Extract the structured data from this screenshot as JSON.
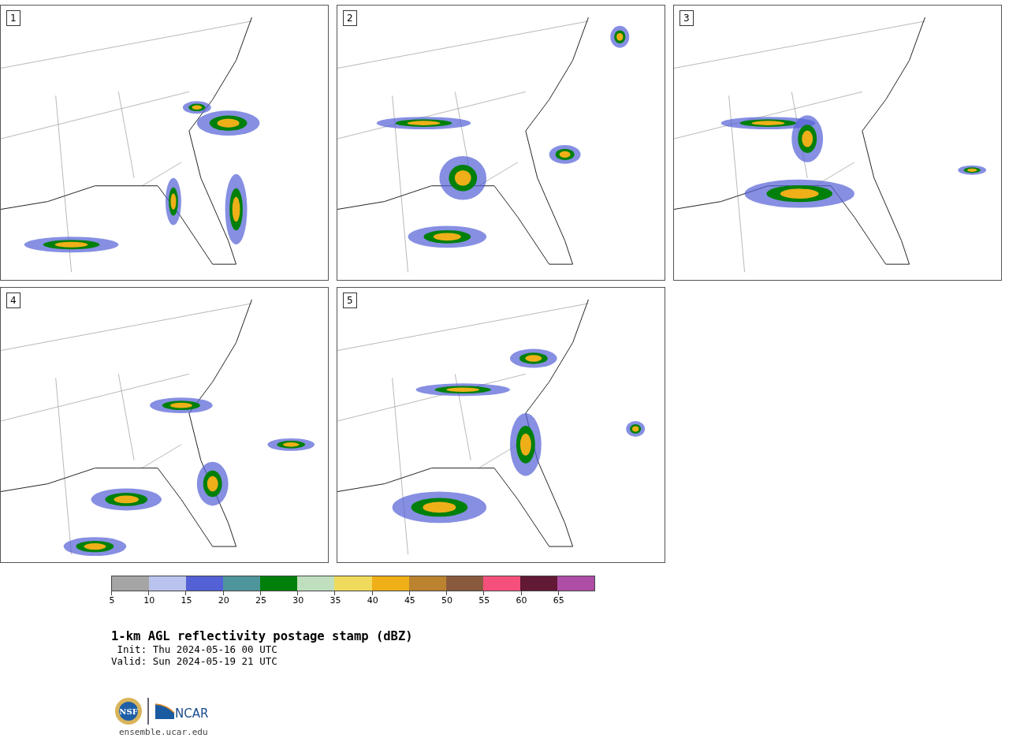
{
  "panels": [
    {
      "label": "1"
    },
    {
      "label": "2"
    },
    {
      "label": "3"
    },
    {
      "label": "4"
    },
    {
      "label": "5"
    }
  ],
  "colorbar": {
    "segments": [
      {
        "color": "#a5a5a5"
      },
      {
        "color": "#b9c3ed"
      },
      {
        "color": "#5360d6"
      },
      {
        "color": "#4e969b"
      },
      {
        "color": "#00800b"
      },
      {
        "color": "#bfdfbf"
      },
      {
        "color": "#f0da5c"
      },
      {
        "color": "#efaf19"
      },
      {
        "color": "#bb8230"
      },
      {
        "color": "#8a5a3e"
      },
      {
        "color": "#f5507c"
      },
      {
        "color": "#621935"
      },
      {
        "color": "#ae4da5"
      }
    ],
    "ticks": [
      "5",
      "10",
      "15",
      "20",
      "25",
      "30",
      "35",
      "40",
      "45",
      "50",
      "55",
      "60",
      "65"
    ]
  },
  "title": "1-km AGL reflectivity postage stamp (dBZ)",
  "init": " Init: Thu 2024-05-16 00 UTC",
  "valid": "Valid: Sun 2024-05-19 21 UTC",
  "logos": {
    "nsf": "NSF",
    "ncar": "NCAR"
  },
  "url": "ensemble.ucar.edu"
}
